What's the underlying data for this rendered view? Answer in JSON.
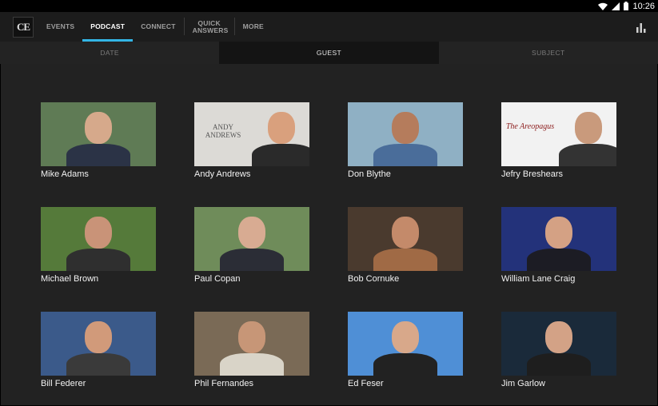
{
  "status": {
    "time": "10:26"
  },
  "app": {
    "logo_text": "CE"
  },
  "nav": {
    "items": [
      {
        "label": "EVENTS",
        "active": false
      },
      {
        "label": "PODCAST",
        "active": true
      },
      {
        "label": "CONNECT",
        "active": false
      },
      {
        "label": "QUICK ANSWERS",
        "active": false
      },
      {
        "label": "MORE",
        "active": false
      }
    ]
  },
  "subtabs": [
    {
      "label": "DATE",
      "active": false
    },
    {
      "label": "GUEST",
      "active": true
    },
    {
      "label": "SUBJECT",
      "active": false
    }
  ],
  "guests": [
    {
      "name": "Mike Adams",
      "bg": "#5f7b55",
      "skin": "#d6a98b",
      "suit": "#2b3346"
    },
    {
      "name": "Andy Andrews",
      "bg": "#dcdad6",
      "skin": "#d9a07d",
      "suit": "#2a2a2a",
      "overlay": "ANDY ANDREWS"
    },
    {
      "name": "Don Blythe",
      "bg": "#8fb0c4",
      "skin": "#b57c5c",
      "suit": "#4a6d9a"
    },
    {
      "name": "Jefry Breshears",
      "bg": "#f2f2f2",
      "skin": "#c99a7c",
      "suit": "#333333",
      "overlay": "The Areopagus"
    },
    {
      "name": "Michael Brown",
      "bg": "#557a3a",
      "skin": "#c99378",
      "suit": "#2f2f2f"
    },
    {
      "name": "Paul Copan",
      "bg": "#6f8c5a",
      "skin": "#d8ab92",
      "suit": "#2b2d36"
    },
    {
      "name": "Bob Cornuke",
      "bg": "#4a3a2e",
      "skin": "#c48a6a",
      "suit": "#a06a45"
    },
    {
      "name": "William Lane Craig",
      "bg": "#23327a",
      "skin": "#d4a184",
      "suit": "#1c1c24"
    },
    {
      "name": "Bill Federer",
      "bg": "#3b5a8a",
      "skin": "#d19a7a",
      "suit": "#3a3a3a"
    },
    {
      "name": "Phil Fernandes",
      "bg": "#7a6a56",
      "skin": "#c79677",
      "suit": "#d9d4c8"
    },
    {
      "name": "Ed Feser",
      "bg": "#4f8fd6",
      "skin": "#d8a88a",
      "suit": "#222222"
    },
    {
      "name": "Jim Garlow",
      "bg": "#1a2a3a",
      "skin": "#d3a286",
      "suit": "#1e1e1e"
    }
  ]
}
